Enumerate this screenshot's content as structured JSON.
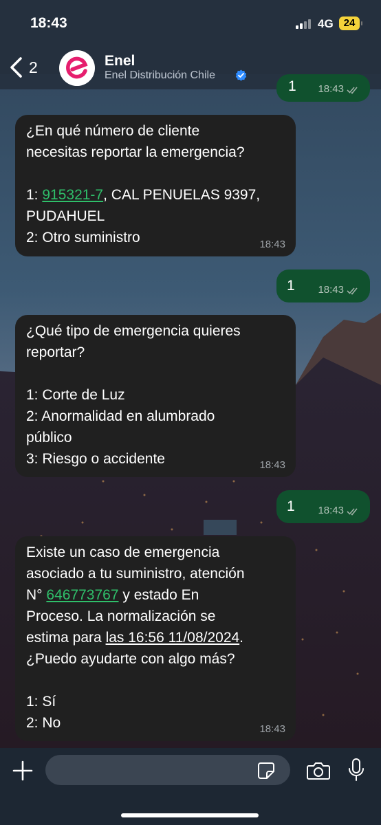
{
  "status_bar": {
    "time": "18:43",
    "network": "4G",
    "battery": "24"
  },
  "header": {
    "back_count": "2",
    "contact_name": "Enel",
    "contact_subtitle": "Enel Distribución Chile",
    "icons": [
      "back-chevron-icon",
      "enel-logo",
      "verified-badge-icon"
    ]
  },
  "messages": [
    {
      "direction": "outgoing",
      "text": "1",
      "time": "18:43",
      "partial": true
    },
    {
      "direction": "incoming",
      "time": "18:43",
      "lines": {
        "l1": "¿En qué número de cliente",
        "l2": "necesitas reportar la emergencia?",
        "l3_prefix": "1: ",
        "l3_link": "915321-7",
        "l3_suffix": ", CAL PENUELAS 9397,",
        "l4": "PUDAHUEL",
        "l5": "2: Otro suministro"
      }
    },
    {
      "direction": "outgoing",
      "text": "1",
      "time": "18:43"
    },
    {
      "direction": "incoming",
      "time": "18:43",
      "lines": {
        "l1": "¿Qué tipo de emergencia quieres",
        "l2": "reportar?",
        "l3": "1: Corte de Luz",
        "l4": "2: Anormalidad en alumbrado",
        "l5": "público",
        "l6": "3: Riesgo o accidente"
      }
    },
    {
      "direction": "outgoing",
      "text": "1",
      "time": "18:43"
    },
    {
      "direction": "incoming",
      "time": "18:43",
      "lines": {
        "l1": "Existe un caso de emergencia",
        "l2": "asociado a tu suministro, atención",
        "l3_prefix": "N° ",
        "l3_link": "646773767",
        "l3_suffix": " y estado En",
        "l4": "Proceso. La normalización se",
        "l5_prefix": "estima para ",
        "l5_underlined": "las 16:56 11/08/2024",
        "l5_suffix": ".",
        "l6": "¿Puedo ayudarte con algo más?",
        "l7": "1: Sí",
        "l8": "2: No"
      }
    }
  ],
  "composer": {
    "placeholder": "",
    "icons": [
      "plus-icon",
      "sticker-icon",
      "camera-icon",
      "microphone-icon"
    ]
  },
  "colors": {
    "incoming_bubble": "#202020",
    "outgoing_bubble": "#10512e",
    "link": "#2fbf6a",
    "header": "#26303e",
    "battery": "#f5d33a"
  }
}
